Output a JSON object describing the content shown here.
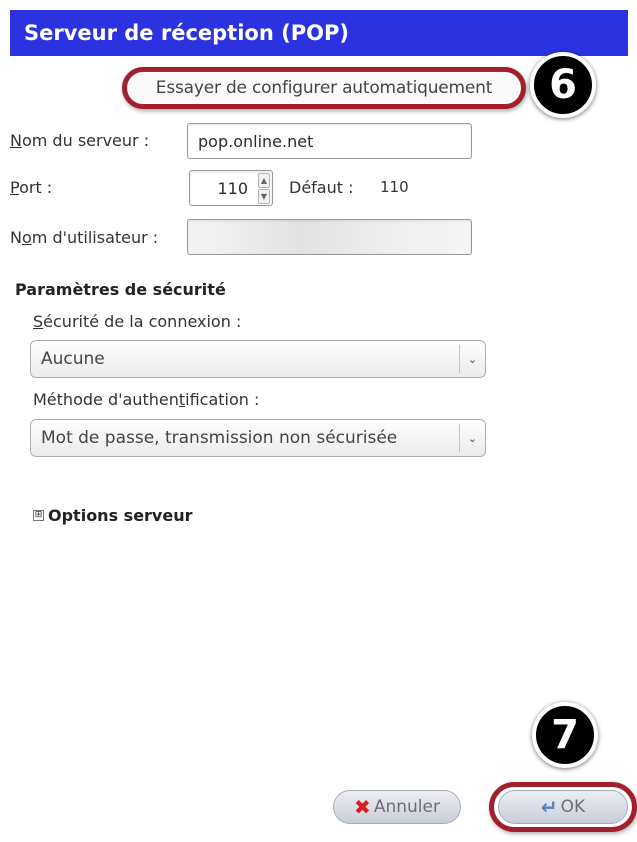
{
  "dialog": {
    "title": "Serveur de réception (POP)"
  },
  "auto_config": {
    "label": "Essayer de configurer automatiquement"
  },
  "steps": {
    "six": "6",
    "seven": "7"
  },
  "server": {
    "label_initial": "N",
    "label_rest": "om du serveur :",
    "value": "pop.online.net"
  },
  "port": {
    "label_initial": "P",
    "label_rest": "ort :",
    "value": "110",
    "default_label": "Défaut :",
    "default_value": "110"
  },
  "username": {
    "label_start": "N",
    "label_underlined": "o",
    "label_end": "m d'utilisateur :",
    "value": ""
  },
  "security": {
    "section_title": "Paramètres de sécurité",
    "connection_label_initial": "S",
    "connection_label_rest": "écurité de la connexion :",
    "connection_value": "Aucune",
    "auth_label_start": "Méthode d'authen",
    "auth_label_underlined": "t",
    "auth_label_end": "ification :",
    "auth_value": "Mot de passe, transmission non sécurisée"
  },
  "server_options": {
    "expander": "⊞",
    "label": "Options serveur"
  },
  "buttons": {
    "cancel_label": "Annuler",
    "ok_label": "OK"
  },
  "colors": {
    "header_bg": "#2b33e0",
    "highlight_ring": "#a0202e",
    "cancel_icon": "#d62020",
    "ok_icon": "#5b7fb8"
  },
  "icons": {
    "cancel": "cancel-x-icon",
    "ok": "ok-arrow-icon",
    "select_arrow": "chevron-down-icon"
  }
}
